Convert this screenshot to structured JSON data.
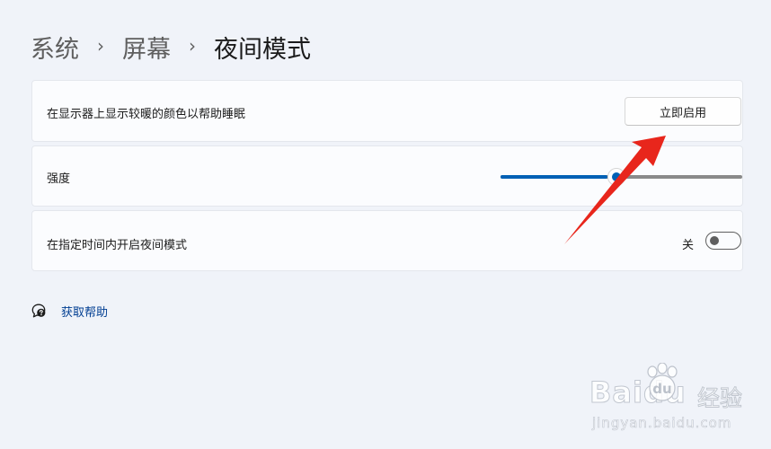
{
  "breadcrumb": {
    "item_1": "系统",
    "item_2": "屏幕",
    "current": "夜间模式",
    "separator": "›"
  },
  "cards": {
    "enable_now": {
      "label": "在显示器上显示较暖的颜色以帮助睡眠",
      "button_label": "立即启用"
    },
    "strength": {
      "label": "强度",
      "value_percent": 48
    },
    "schedule": {
      "label": "在指定时间内开启夜间模式",
      "state_text": "关",
      "enabled": false
    }
  },
  "help": {
    "label": "获取帮助",
    "icon": "help-chat-icon"
  },
  "annotation": {
    "type": "red-arrow",
    "color": "#e8261c",
    "points_to": "enable-now-button"
  },
  "watermark": {
    "logo": "Baidu",
    "product": "经验",
    "url": "jingyan.baidu.com"
  },
  "colors": {
    "accent": "#0061b5",
    "link": "#003e92",
    "background": "#f0f3f9",
    "card": "#fbfcfe"
  }
}
